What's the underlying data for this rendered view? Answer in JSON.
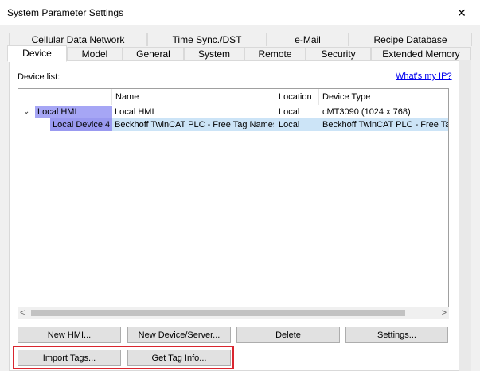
{
  "window": {
    "title": "System Parameter Settings",
    "close_glyph": "✕"
  },
  "tabs_back": [
    {
      "label": "Cellular Data Network"
    },
    {
      "label": "Time Sync./DST"
    },
    {
      "label": "e-Mail"
    },
    {
      "label": "Recipe Database"
    }
  ],
  "tabs_front": [
    {
      "label": "Device",
      "active": true
    },
    {
      "label": "Model"
    },
    {
      "label": "General"
    },
    {
      "label": "System"
    },
    {
      "label": "Remote"
    },
    {
      "label": "Security"
    },
    {
      "label": "Extended Memory"
    }
  ],
  "device_list": {
    "label": "Device list:",
    "whats_my_ip": "What's my IP?",
    "columns": [
      "Name",
      "Location",
      "Device Type"
    ],
    "rows": [
      {
        "tree_label": "Local HMI",
        "expand_icon": "chevron-down-icon",
        "expand_glyph": "⌄",
        "name": "Local HMI",
        "location": "Local",
        "device_type": "cMT3090 (1024 x 768)"
      },
      {
        "tree_label": "Local Device 4",
        "name": "Beckhoff TwinCAT PLC - Free Tag Names",
        "location": "Local",
        "device_type": "Beckhoff TwinCAT PLC - Free Ta",
        "selected": true
      }
    ],
    "hscroll_left": "<",
    "hscroll_right": ">"
  },
  "buttons": {
    "new_hmi": "New HMI...",
    "new_device": "New Device/Server...",
    "delete": "Delete",
    "settings": "Settings...",
    "import_tags": "Import Tags...",
    "get_tag_info": "Get Tag Info..."
  },
  "colors": {
    "tree_hmi": "#a6a6f5",
    "tree_device": "#9999f0",
    "row_selected": "#cce4f7",
    "highlight_box": "#d9262f",
    "link": "#0000ee"
  }
}
